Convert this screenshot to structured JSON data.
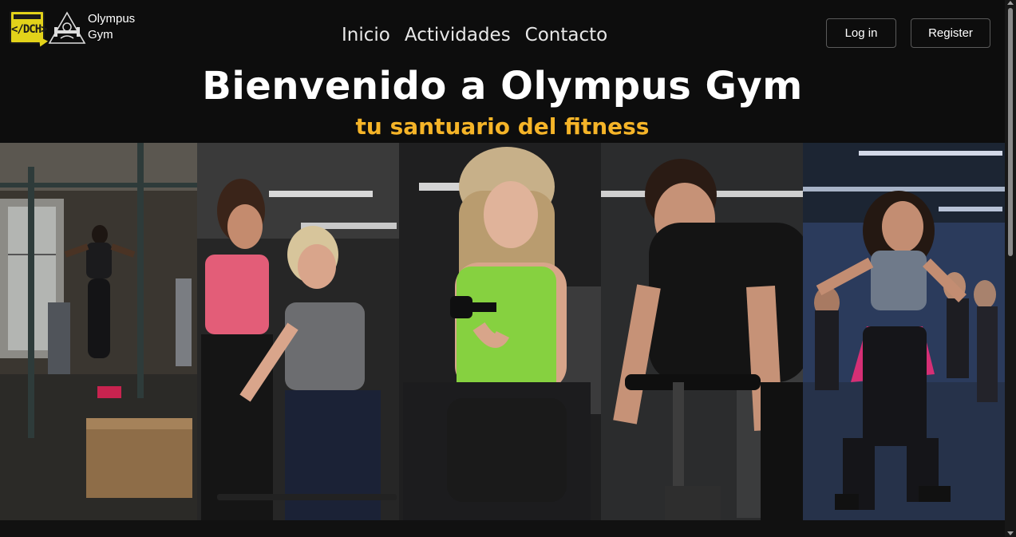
{
  "brand": {
    "dev_logo_text": "</DCH>",
    "name_line1": "Olympus",
    "name_line2": "Gym"
  },
  "nav": {
    "items": [
      {
        "label": "Inicio"
      },
      {
        "label": "Actividades"
      },
      {
        "label": "Contacto"
      }
    ]
  },
  "auth": {
    "login_label": "Log in",
    "register_label": "Register"
  },
  "hero": {
    "title": "Bienvenido a Olympus Gym",
    "subtitle": "tu santuario del fitness"
  },
  "gallery": {
    "photos": [
      {
        "name": "crossfit-ring-photo"
      },
      {
        "name": "trainer-squat-photo"
      },
      {
        "name": "dumbbell-curl-photo"
      },
      {
        "name": "spin-bike-photo"
      },
      {
        "name": "dance-class-photo"
      }
    ]
  },
  "colors": {
    "background": "#0d0d0d",
    "accent": "#f5b428",
    "dev_logo": "#e2d21a"
  }
}
